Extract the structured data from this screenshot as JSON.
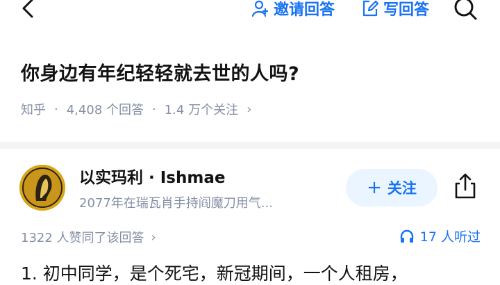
{
  "header": {
    "invite_label": "邀请回答",
    "write_label": "写回答"
  },
  "question": {
    "title": "你身边有年纪轻轻就去世的人吗?",
    "source": "知乎",
    "answers_count": "4,408 个回答",
    "followers_count": "1.4 万个关注"
  },
  "answer": {
    "author_name": "以实玛利 · Ishmae",
    "author_bio": "2077年在瑞瓦肖手持阎魔刀用气...",
    "follow_label": "关注",
    "upvote_text": "1322 人赞同了该回答",
    "listen_text": "17 人听过",
    "text_preview": "1. 初中同学，是个死宅，新冠期间，一个人租房，"
  },
  "colors": {
    "accent": "#1772f6",
    "muted": "#8590a6",
    "follow_bg": "#ebf5ff",
    "avatar_bg": "#d9a51b"
  },
  "icons": [
    "back-icon",
    "invite-user-icon",
    "edit-icon",
    "search-icon",
    "share-icon",
    "headphones-icon",
    "chevron-right-icon"
  ]
}
